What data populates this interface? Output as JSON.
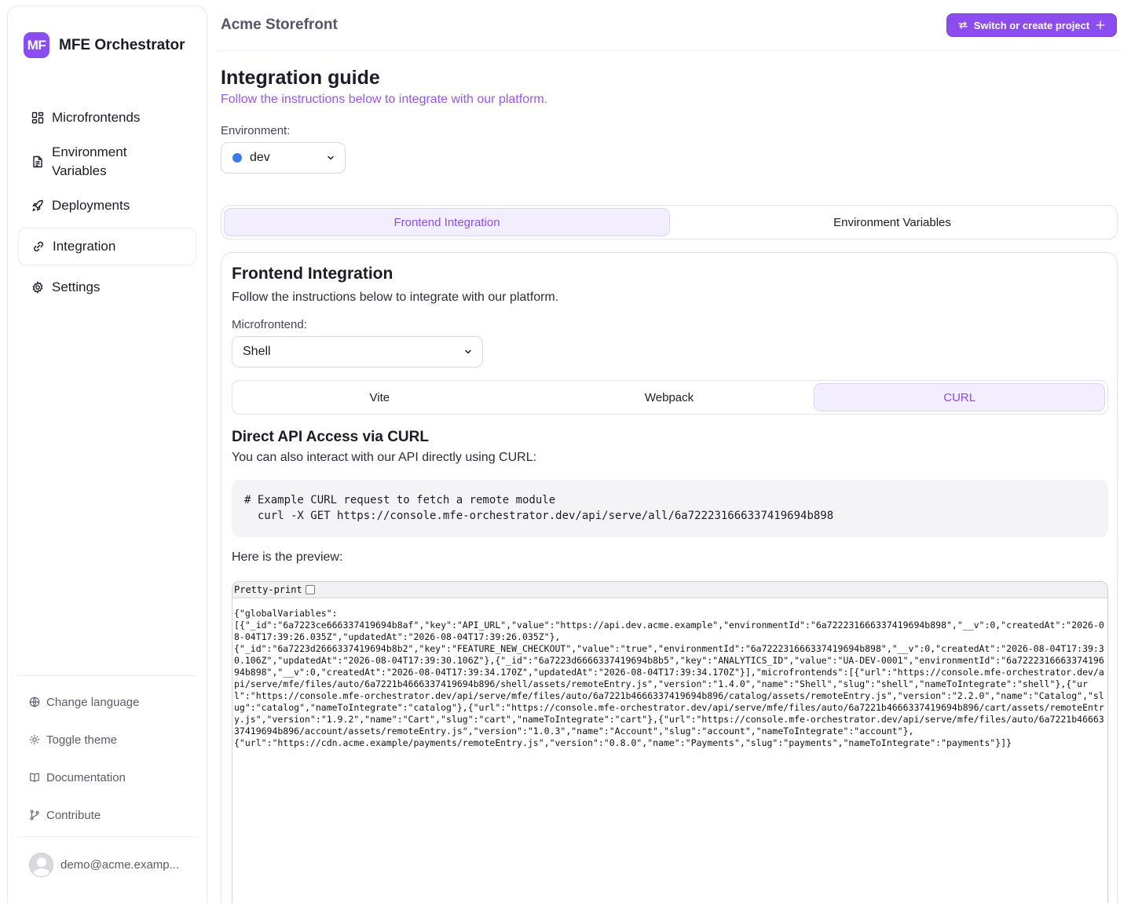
{
  "brand": {
    "logo_text": "MF",
    "name": "MFE Orchestrator"
  },
  "sidebar": {
    "items": [
      {
        "label": "Microfrontends",
        "icon": "grid-icon"
      },
      {
        "label": "Environment\nVariables",
        "icon": "document-icon"
      },
      {
        "label": "Deployments",
        "icon": "rocket-icon"
      },
      {
        "label": "Integration",
        "icon": "link-icon",
        "active": true
      },
      {
        "label": "Settings",
        "icon": "gear-icon"
      }
    ],
    "footer": [
      {
        "label": "Change language",
        "icon": "globe-icon"
      },
      {
        "label": "Toggle theme",
        "icon": "sun-icon"
      },
      {
        "label": "Documentation",
        "icon": "book-icon"
      },
      {
        "label": "Contribute",
        "icon": "git-branch-icon"
      }
    ],
    "user_email": "demo@acme.examp..."
  },
  "header": {
    "project_name": "Acme Storefront",
    "switch_label": "Switch or create project"
  },
  "main": {
    "title": "Integration guide",
    "subtitle": "Follow the instructions below to integrate with our platform.",
    "environment_label": "Environment:",
    "environment_value": "dev",
    "tabs": [
      "Frontend Integration",
      "Environment Variables"
    ],
    "active_tab": 0
  },
  "card": {
    "title": "Frontend Integration",
    "subtitle": "Follow the instructions below to integrate with our platform.",
    "mfe_label": "Microfrontend:",
    "mfe_value": "Shell",
    "tabs": [
      "Vite",
      "Webpack",
      "CURL"
    ],
    "active_tab": 2,
    "section_title": "Direct API Access via CURL",
    "section_subtitle": "You can also interact with our API directly using CURL:",
    "code": "# Example CURL request to fetch a remote module\n  curl -X GET https://console.mfe-orchestrator.dev/api/serve/all/6a722231666337419694b898",
    "preview_label": "Here is the preview:",
    "pretty_print_label": "Pretty-print",
    "preview_json": "{\"globalVariables\":\n[{\"_id\":\"6a7223ce666337419694b8af\",\"key\":\"API_URL\",\"value\":\"https://api.dev.acme.example\",\"environmentId\":\"6a722231666337419694b898\",\"__v\":0,\"createdAt\":\"2026-08-04T17:39:26.035Z\",\"updatedAt\":\"2026-08-04T17:39:26.035Z\"},\n{\"_id\":\"6a7223d2666337419694b8b2\",\"key\":\"FEATURE_NEW_CHECKOUT\",\"value\":\"true\",\"environmentId\":\"6a722231666337419694b898\",\"__v\":0,\"createdAt\":\"2026-08-04T17:39:30.106Z\",\"updatedAt\":\"2026-08-04T17:39:30.106Z\"},{\"_id\":\"6a7223d6666337419694b8b5\",\"key\":\"ANALYTICS_ID\",\"value\":\"UA-DEV-0001\",\"environmentId\":\"6a722231666337419694b898\",\"__v\":0,\"createdAt\":\"2026-08-04T17:39:34.170Z\",\"updatedAt\":\"2026-08-04T17:39:34.170Z\"}],\"microfrontends\":[{\"url\":\"https://console.mfe-orchestrator.dev/api/serve/mfe/files/auto/6a7221b4666337419694b896/shell/assets/remoteEntry.js\",\"version\":\"1.4.0\",\"name\":\"Shell\",\"slug\":\"shell\",\"nameToIntegrate\":\"shell\"},{\"url\":\"https://console.mfe-orchestrator.dev/api/serve/mfe/files/auto/6a7221b4666337419694b896/catalog/assets/remoteEntry.js\",\"version\":\"2.2.0\",\"name\":\"Catalog\",\"slug\":\"catalog\",\"nameToIntegrate\":\"catalog\"},{\"url\":\"https://console.mfe-orchestrator.dev/api/serve/mfe/files/auto/6a7221b4666337419694b896/cart/assets/remoteEntry.js\",\"version\":\"1.9.2\",\"name\":\"Cart\",\"slug\":\"cart\",\"nameToIntegrate\":\"cart\"},{\"url\":\"https://console.mfe-orchestrator.dev/api/serve/mfe/files/auto/6a7221b4666337419694b896/account/assets/remoteEntry.js\",\"version\":\"1.0.3\",\"name\":\"Account\",\"slug\":\"account\",\"nameToIntegrate\":\"account\"},\n{\"url\":\"https://cdn.acme.example/payments/remoteEntry.js\",\"version\":\"0.8.0\",\"name\":\"Payments\",\"slug\":\"payments\",\"nameToIntegrate\":\"payments\"}]}"
  },
  "colors": {
    "accent": "#8b4cf0",
    "env_dot": "#3b7bef"
  }
}
